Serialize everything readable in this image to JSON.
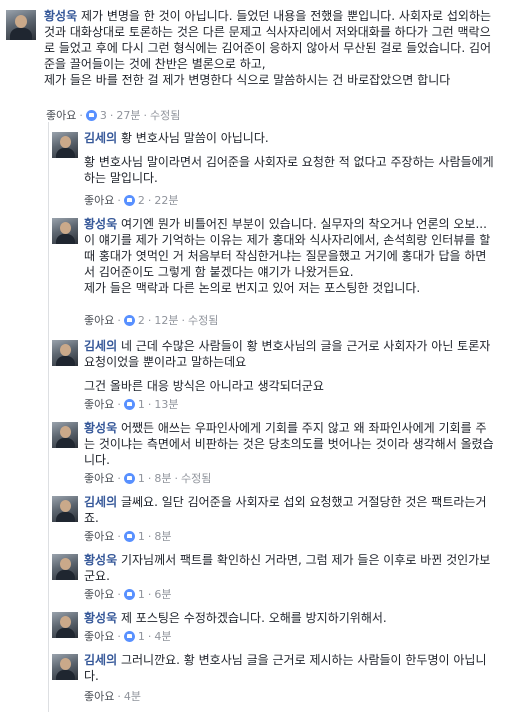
{
  "comments": [
    {
      "author": "황성욱",
      "paragraphs": [
        "제가 변명을 한 것이 아닙니다. 들었던 내용을 전했을 뿐입니다. 사회자로 섭외하는 것과 대화상대로 토론하는 것은 다른 문제고 식사자리에서 저와대화를 하다가 그런 맥락으로 들었고 후에 다시 그런 형식에는 김어준이 응하지 않아서 무산된 걸로 들었습니다. 김어준을 끌어들이는 것에 찬반은 별론으로 하고,",
        "제가 들은 바를 전한 걸 제가 변명한다 식으로 말씀하시는 건 바로잡았으면 합니다"
      ],
      "like": "좋아요",
      "reactions": "3",
      "time": "27분",
      "edited": "수정됨"
    },
    {
      "author": "김세의",
      "paragraphs": [
        "황 변호사님 말씀이 아닙니다.",
        "황 변호사님 말이라면서 김어준을 사회자로 요청한 적 없다고 주장하는 사람들에게 하는 말입니다."
      ],
      "like": "좋아요",
      "reactions": "2",
      "time": "22분",
      "edited": ""
    },
    {
      "author": "황성욱",
      "paragraphs": [
        "여기엔 뭔가 비틀어진 부분이 있습니다. 실무자의 착오거나 언론의 오보... 이 얘기를 제가 기억하는 이유는 제가 홍대와 식사자리에서, 손석희랑 인터뷰를 할때 홍대가 엿먹인 거 처음부터 작심한거냐는 질문을했고 거기에 홍대가 답을 하면서 김어준이도 그렇게 함 붙겠다는 얘기가 나왔거든요.",
        "제가 들은 맥락과 다른 논의로 번지고 있어 저는 포스팅한 것입니다."
      ],
      "like": "좋아요",
      "reactions": "2",
      "time": "12분",
      "edited": "수정됨"
    },
    {
      "author": "김세의",
      "paragraphs": [
        "네 근데 수많은 사람들이 황 변호사님의 글을 근거로 사회자가 아닌 토론자 요청이었을 뿐이라고 말하는데요",
        "그건 올바른 대응 방식은 아니라고 생각되더군요"
      ],
      "like": "좋아요",
      "reactions": "1",
      "time": "13분",
      "edited": ""
    },
    {
      "author": "황성욱",
      "paragraphs": [
        "어쨌든 애쓰는 우파인사에게 기회를 주지 않고 왜 좌파인사에게 기회를 주는 것이냐는 측면에서 비판하는 것은 당초의도를 벗어나는 것이라 생각해서 올렸습니다."
      ],
      "like": "좋아요",
      "reactions": "1",
      "time": "8분",
      "edited": "수정됨"
    },
    {
      "author": "김세의",
      "paragraphs": [
        "글쎄요. 일단 김어준을 사회자로 섭외 요청했고 거절당한 것은 팩트라는거죠."
      ],
      "like": "좋아요",
      "reactions": "1",
      "time": "8분",
      "edited": ""
    },
    {
      "author": "황성욱",
      "paragraphs": [
        "기자님께서 팩트를 확인하신 거라면, 그럼 제가 들은 이후로 바뀐 것인가보군요."
      ],
      "like": "좋아요",
      "reactions": "1",
      "time": "6분",
      "edited": ""
    },
    {
      "author": "황성욱",
      "paragraphs": [
        "제 포스팅은 수정하겠습니다. 오해를 방지하기위해서."
      ],
      "like": "좋아요",
      "reactions": "1",
      "time": "4분",
      "edited": ""
    },
    {
      "author": "김세의",
      "paragraphs": [
        "그러니깐요. 황 변호사님 글을 근거로 제시하는 사람들이 한두명이 아닙니다."
      ],
      "like": "좋아요",
      "reactions": "",
      "time": "4분",
      "edited": ""
    }
  ]
}
